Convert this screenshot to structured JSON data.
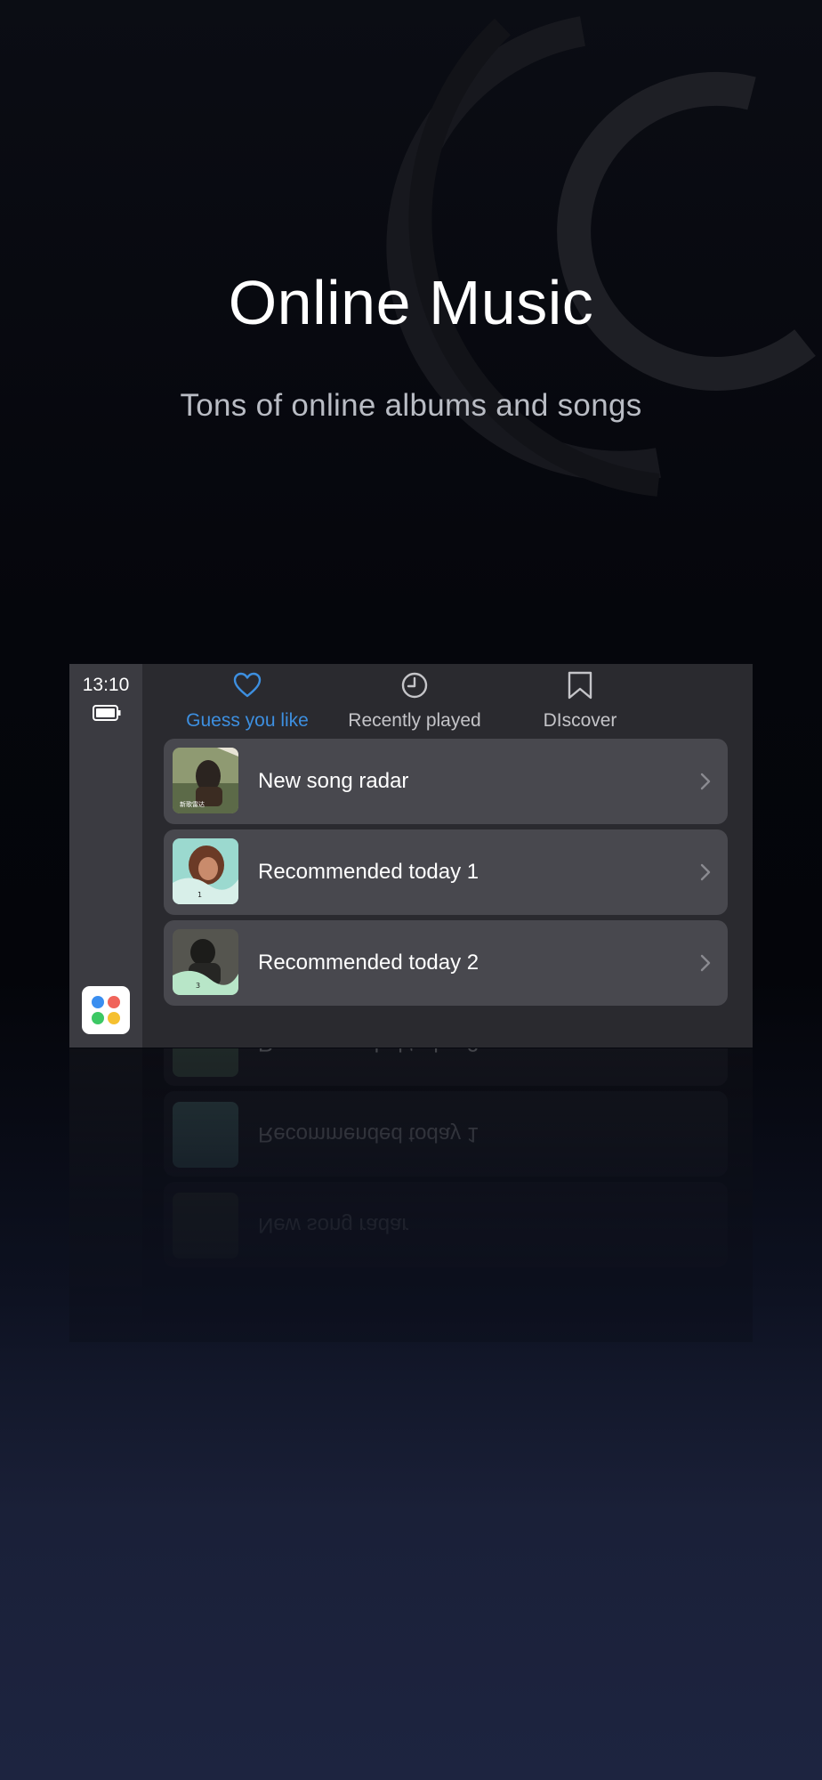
{
  "hero": {
    "title": "Online Music",
    "subtitle": "Tons of online albums and songs"
  },
  "status": {
    "time": "13:10",
    "battery_icon": "battery-icon"
  },
  "tabs": [
    {
      "label": "Guess you like",
      "icon": "heart-icon",
      "active": true,
      "color": "#3d8fe0"
    },
    {
      "label": "Recently played",
      "icon": "clock-icon",
      "active": false,
      "color": "#c4c4c8"
    },
    {
      "label": "DIscover",
      "icon": "bookmark-icon",
      "active": false,
      "color": "#c4c4c8"
    }
  ],
  "list": {
    "items": [
      {
        "title": "New song radar",
        "thumb_caption": "新歌雷达"
      },
      {
        "title": "Recommended today 1",
        "thumb_caption": "1"
      },
      {
        "title": "Recommended today 2",
        "thumb_caption": "3"
      }
    ]
  },
  "colors": {
    "accent": "#3d8fe0",
    "screen_bg": "#2a2a2f",
    "sidebar_bg": "#3b3b41",
    "row_bg": "#48484e"
  }
}
